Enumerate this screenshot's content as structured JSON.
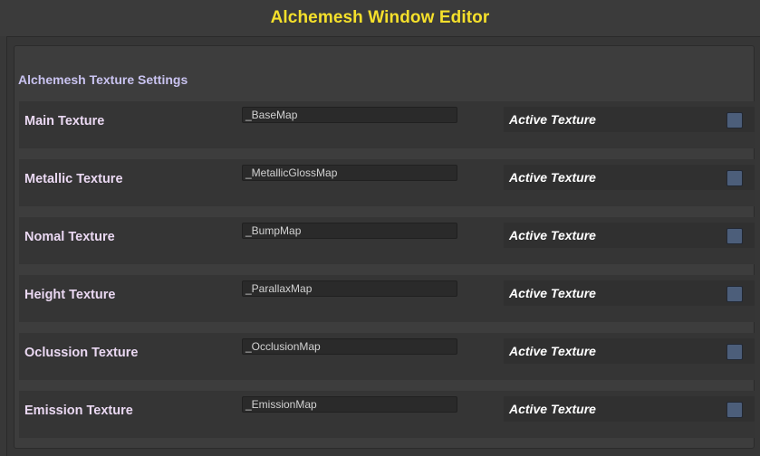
{
  "window": {
    "title": "Alchemesh Window Editor"
  },
  "section": {
    "title": "Alchemesh Texture Settings"
  },
  "rows": [
    {
      "label": "Main Texture",
      "property": "_BaseMap",
      "toggle_label": "Active Texture",
      "checked": false
    },
    {
      "label": "Metallic Texture",
      "property": "_MetallicGlossMap",
      "toggle_label": "Active Texture",
      "checked": false
    },
    {
      "label": "Nomal Texture",
      "property": "_BumpMap",
      "toggle_label": "Active Texture",
      "checked": false
    },
    {
      "label": "Height Texture",
      "property": "_ParallaxMap",
      "toggle_label": "Active Texture",
      "checked": false
    },
    {
      "label": "Oclussion Texture",
      "property": "_OcclusionMap",
      "toggle_label": "Active Texture",
      "checked": false
    },
    {
      "label": "Emission Texture",
      "property": "_EmissionMap",
      "toggle_label": "Active Texture",
      "checked": false
    }
  ],
  "colors": {
    "title": "#f5e02b",
    "section_title": "#c9c3f0",
    "row_label": "#ead8f2",
    "checkbox_fill": "#4c5e7a"
  }
}
